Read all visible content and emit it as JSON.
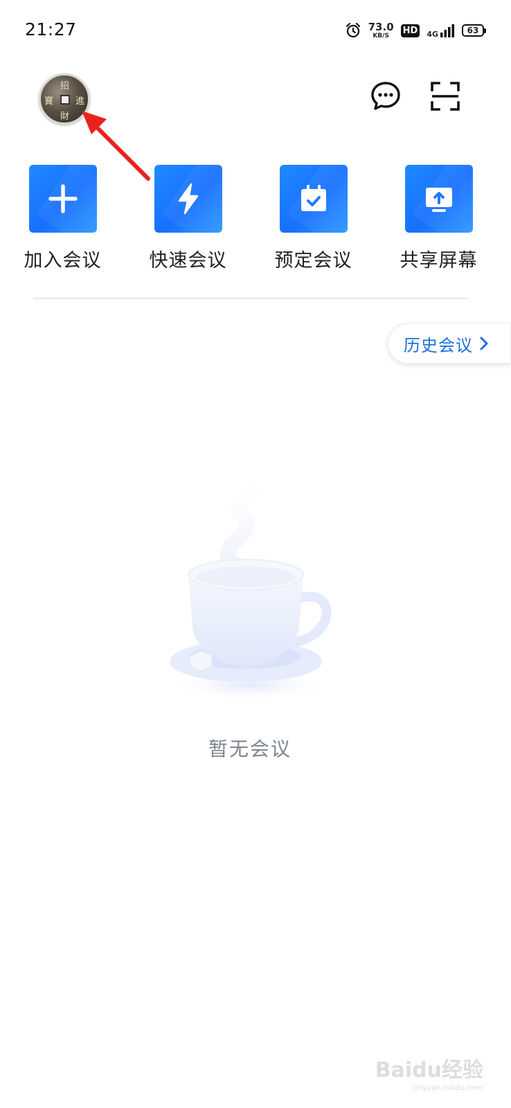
{
  "status_bar": {
    "time": "21:27",
    "net_speed_value": "73.0",
    "net_speed_unit": "KB/S",
    "hd_badge": "HD",
    "network_type": "4G",
    "battery": "63"
  },
  "header": {
    "avatar_glyphs": [
      "招",
      "進",
      "財",
      "寶"
    ],
    "message_icon": "message-bubble-icon",
    "scan_icon": "scan-icon"
  },
  "quick_actions": [
    {
      "label": "加入会议",
      "icon": "plus-icon"
    },
    {
      "label": "快速会议",
      "icon": "lightning-icon"
    },
    {
      "label": "预定会议",
      "icon": "calendar-check-icon"
    },
    {
      "label": "共享屏幕",
      "icon": "screen-share-icon"
    }
  ],
  "history": {
    "label": "历史会议"
  },
  "empty_state": {
    "text": "暂无会议",
    "illustration": "coffee-cup-illustration"
  },
  "watermark": {
    "main": "Baidu经验",
    "sub": "jingyan.baidu.com"
  },
  "colors": {
    "accent": "#1770ff",
    "history_text": "#1a6fe0",
    "annotation_arrow": "#e8231e"
  }
}
